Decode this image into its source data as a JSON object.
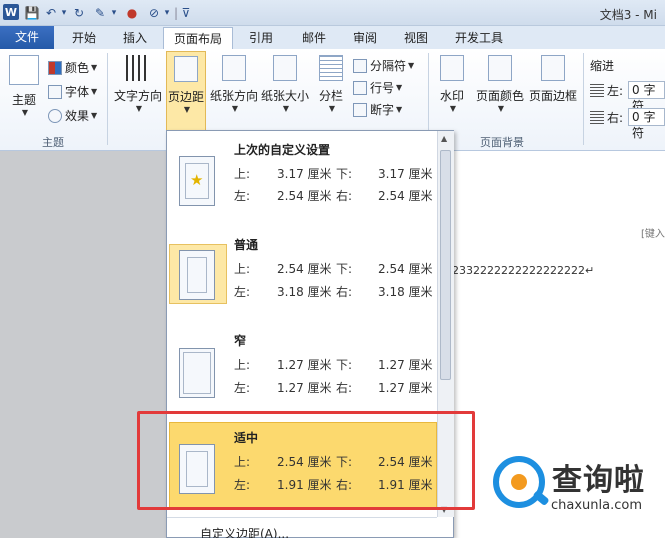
{
  "window": {
    "logo": "W",
    "title": "文档3 - Mi"
  },
  "quick_access": [
    "💾",
    "↶",
    "▾",
    "↻",
    "✎",
    "▾",
    "●",
    "⊘",
    "▾",
    "|",
    "⊽"
  ],
  "tabs": [
    "文件",
    "开始",
    "插入",
    "页面布局",
    "引用",
    "邮件",
    "审阅",
    "视图",
    "开发工具"
  ],
  "ribbon": {
    "theme": {
      "label": "主题",
      "colors": "颜色",
      "fonts": "字体",
      "effects": "效果",
      "group": "主题"
    },
    "text_direction": "文字方向",
    "margins": "页边距",
    "orientation": "纸张方向",
    "size": "纸张大小",
    "columns": "分栏",
    "breaks": "分隔符",
    "line_numbers": "行号",
    "hyphenation": "断字",
    "watermark": "水印",
    "page_color": "页面颜色",
    "page_borders": "页面边框",
    "page_bg_group": "页面背景",
    "indent": {
      "title": "缩进",
      "left_label": "左:",
      "left_value": "0 字符",
      "right_label": "右:",
      "right_value": "0 字符"
    }
  },
  "document": {
    "text": "2332222222222222222↵",
    "hint": "[键入"
  },
  "margins_menu": {
    "options": [
      {
        "name": "上次的自定义设置",
        "top_label": "上:",
        "top": "3.17 厘米",
        "bottom_label": "下:",
        "bottom": "3.17 厘米",
        "left_label": "左:",
        "left": "2.54 厘米",
        "right_label": "右:",
        "right": "2.54 厘米"
      },
      {
        "name": "普通",
        "top_label": "上:",
        "top": "2.54 厘米",
        "bottom_label": "下:",
        "bottom": "2.54 厘米",
        "left_label": "左:",
        "left": "3.18 厘米",
        "right_label": "右:",
        "right": "3.18 厘米"
      },
      {
        "name": "窄",
        "top_label": "上:",
        "top": "1.27 厘米",
        "bottom_label": "下:",
        "bottom": "1.27 厘米",
        "left_label": "左:",
        "left": "1.27 厘米",
        "right_label": "右:",
        "right": "1.27 厘米"
      },
      {
        "name": "适中",
        "top_label": "上:",
        "top": "2.54 厘米",
        "bottom_label": "下:",
        "bottom": "2.54 厘米",
        "left_label": "左:",
        "left": "1.91 厘米",
        "right_label": "右:",
        "right": "1.91 厘米"
      }
    ],
    "custom": "自定义边距(A)..."
  },
  "watermark_logo": {
    "text": "查询啦",
    "sub": "chaxunla.com"
  },
  "colors": {
    "file_tab": "#2b5fb0",
    "highlight": "#fcd96e",
    "red_frame": "#e23a3a"
  }
}
